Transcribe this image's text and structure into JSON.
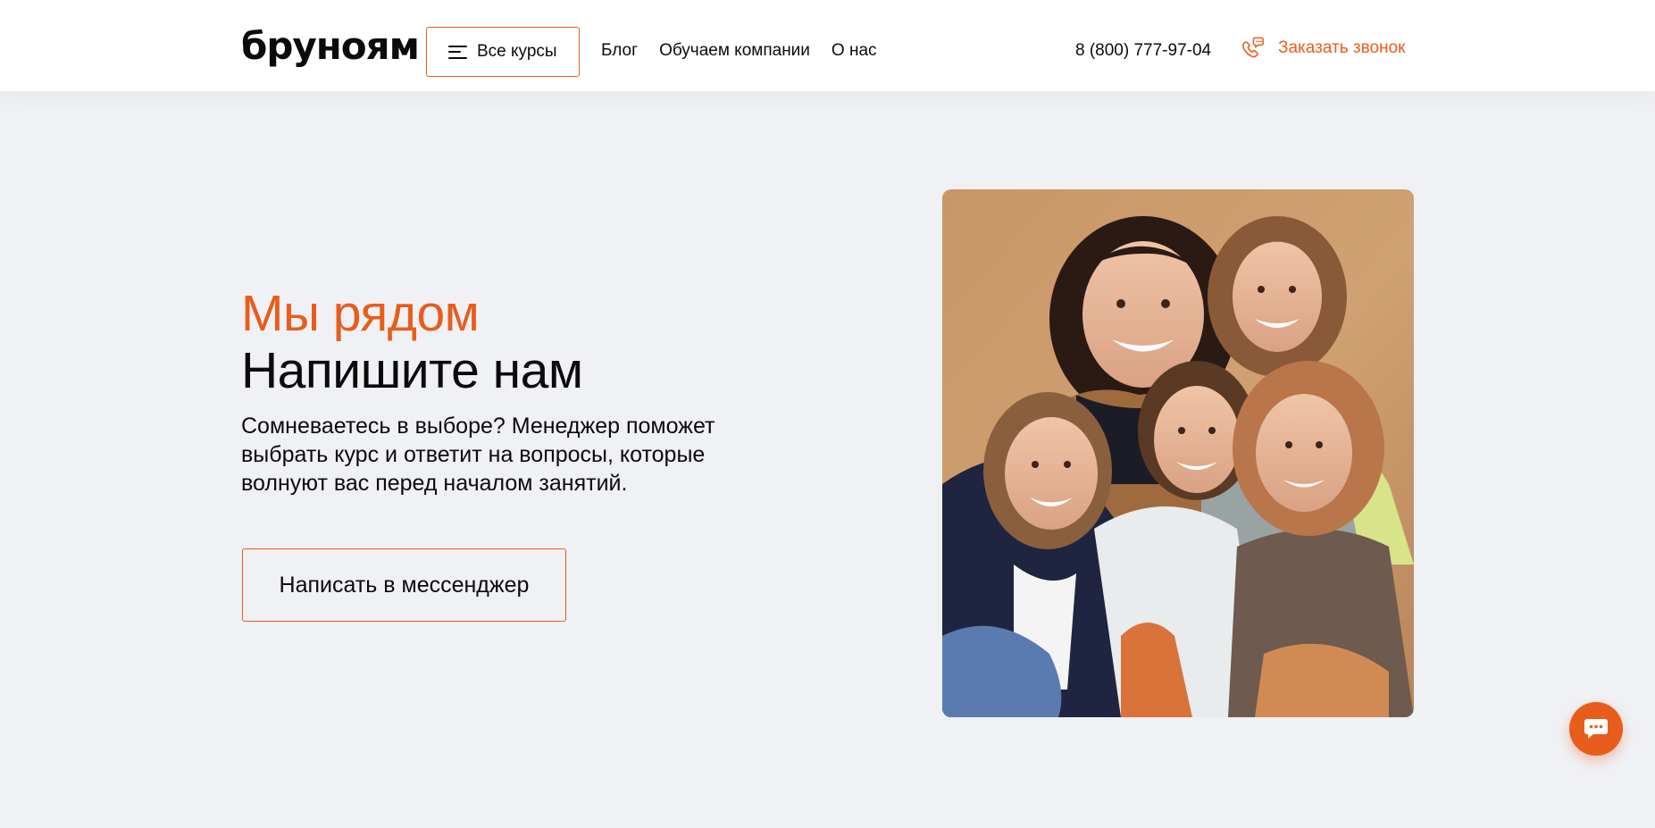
{
  "header": {
    "logo": "бруноям",
    "courses_button": "Все курсы",
    "nav": [
      "Блог",
      "Обучаем компании",
      "О нас"
    ],
    "phone": "8 (800) 777-97-04",
    "callback": "Заказать звонок"
  },
  "hero": {
    "subtitle": "Мы рядом",
    "title": "Напишите нам",
    "description": "Сомневаетесь в выборе? Менеджер поможет выбрать курс и ответит на вопросы, которые волнуют вас перед началом занятий.",
    "cta": "Написать в мессенджер",
    "photo_icon": "group-photo"
  },
  "widgets": {
    "chat_icon": "chat-bubble-icon"
  },
  "colors": {
    "accent": "#e85d1c",
    "background": "#f0f1f5",
    "header_bg": "#ffffff",
    "text": "#0b0b0b"
  }
}
